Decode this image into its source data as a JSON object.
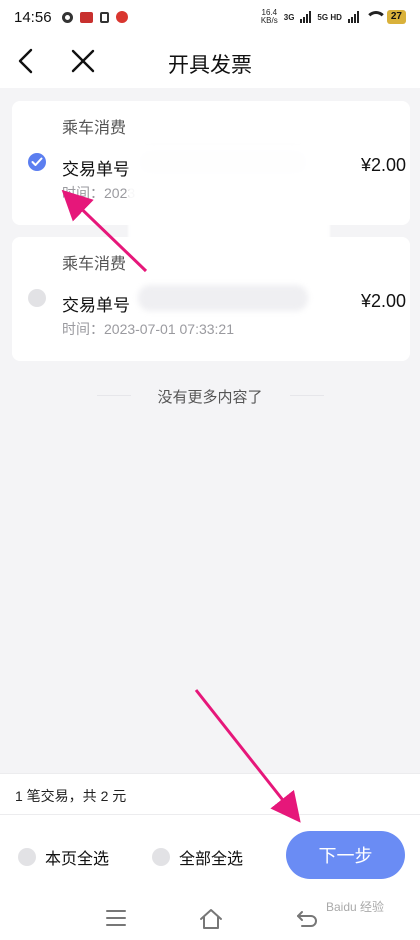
{
  "status_bar": {
    "time": "14:56",
    "net_speed_value": "16.4",
    "net_speed_unit": "KB/s",
    "net_3g": "3G",
    "net_5g": "5G HD",
    "battery": "27",
    "icons": [
      "gear-icon",
      "app-notification-icon",
      "lock-icon",
      "app-red-icon",
      "signal-icon",
      "wifi-icon",
      "battery-icon"
    ]
  },
  "header": {
    "title": "开具发票",
    "back_icon": "chevron-left-icon",
    "close_icon": "close-icon"
  },
  "transactions": [
    {
      "category": "乘车消费",
      "label": "交易单号",
      "amount": "¥2.00",
      "time_prefix": "时间：",
      "time": "2023",
      "selected": true
    },
    {
      "category": "乘车消费",
      "label": "交易单号",
      "amount": "¥2.00",
      "time_prefix": "时间：",
      "time": "2023-07-01 07:33:21",
      "selected": false
    }
  ],
  "list_end_text": "没有更多内容了",
  "summary": {
    "text": "1 笔交易，共 2 元"
  },
  "actions": {
    "select_page_label": "本页全选",
    "select_all_label": "全部全选",
    "next_label": "下一步",
    "accent_color": "#6a8cf4"
  },
  "nav_bar": {
    "icons": [
      "menu-icon",
      "home-icon",
      "back-icon"
    ]
  },
  "watermark": "Baidu 经验"
}
